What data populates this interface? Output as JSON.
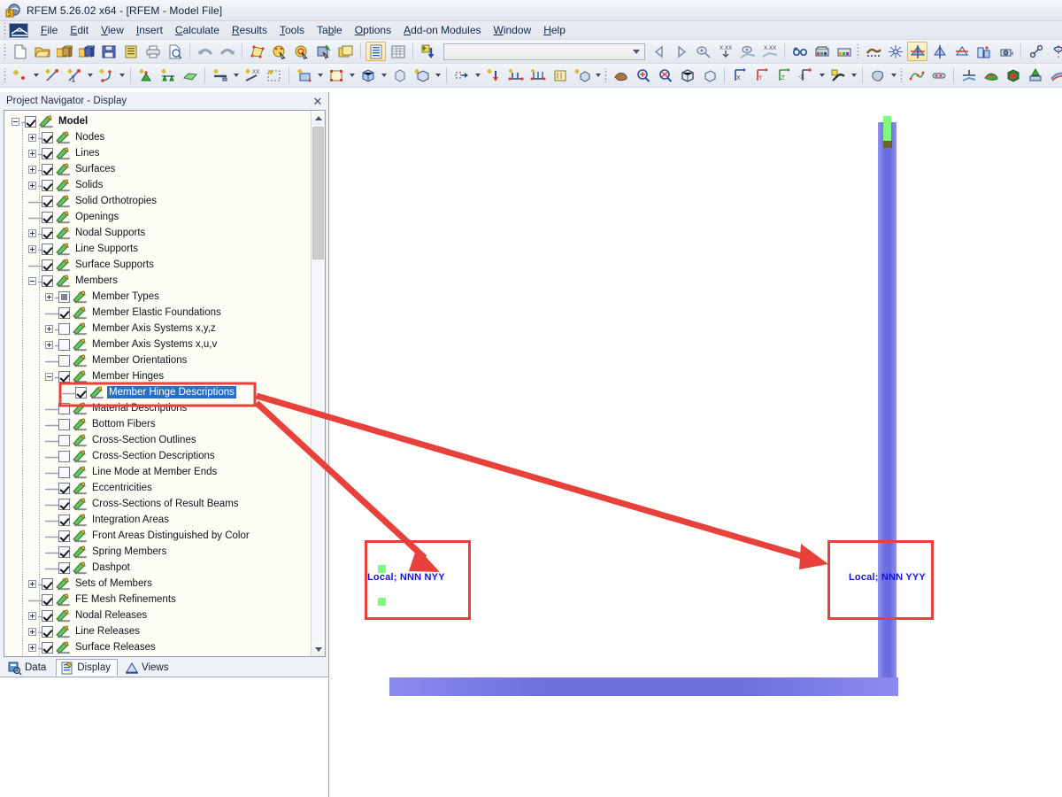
{
  "window": {
    "title": "RFEM 5.26.02 x64 - [RFEM - Model File]",
    "app_icon": "rfem-app-icon"
  },
  "menubar": {
    "app_icon": "rfem-menu-icon",
    "items": [
      {
        "label": "File",
        "accel": "F"
      },
      {
        "label": "Edit",
        "accel": "E"
      },
      {
        "label": "View",
        "accel": "V"
      },
      {
        "label": "Insert",
        "accel": "I"
      },
      {
        "label": "Calculate",
        "accel": "C"
      },
      {
        "label": "Results",
        "accel": "R"
      },
      {
        "label": "Tools",
        "accel": "T"
      },
      {
        "label": "Table",
        "accel": "b"
      },
      {
        "label": "Options",
        "accel": "O"
      },
      {
        "label": "Add-on Modules",
        "accel": "A"
      },
      {
        "label": "Window",
        "accel": "W"
      },
      {
        "label": "Help",
        "accel": "H"
      }
    ]
  },
  "toolbar_top": {
    "combo_value": "",
    "buttons": [
      "new-file-icon",
      "open-file-icon",
      "open-package-icon",
      "save-package-icon",
      "save-icon",
      "clipboard-icon",
      "print-icon",
      "print-preview-icon",
      "undo-icon",
      "redo-icon",
      "edit-model-icon",
      "select-by-mouse-icon",
      "select-special-icon",
      "select-add-icon",
      "new-window-icon",
      "table-list-icon",
      "table-grid-icon",
      "insert-object-icon"
    ],
    "buttons_right": [
      "prev-result-icon",
      "next-result-icon",
      "result-value-icon",
      "result-value-xxx-icon",
      "result-diagram-icon",
      "result-diagram-xxx-icon",
      "glasses-icon",
      "render-colors-icon",
      "render-colors2-icon",
      "fe-mesh-icon",
      "mesh-settings-icon",
      "view-model-icon",
      "view-model2-icon",
      "view-model3-icon",
      "view-building-icon",
      "camera-icon",
      "snap-icon",
      "mirror-icon",
      "mirror2-icon",
      "snap-grid-icon",
      "info-icon",
      "settings-icon",
      "gears-icon"
    ]
  },
  "toolbar_second": {
    "buttons": [
      "new-node-icon",
      "new-line-icon",
      "new-line-dim-icon",
      "new-polyline-icon",
      "new-support-icon",
      "new-line-support-icon",
      "new-surface-icon",
      "new-member-icon",
      "new-member-xx-icon",
      "new-member-select-icon",
      "new-area-icon",
      "new-frame-icon",
      "new-solid-icon",
      "new-solid2-icon",
      "new-box-icon",
      "new-opening-icon",
      "new-load-icon",
      "new-nodal-load-icon",
      "new-member-load-icon",
      "new-line-load-icon",
      "new-surface-load-icon",
      "new-free-load-icon",
      "pan-icon",
      "zoom-in-icon",
      "zoom-out-icon",
      "zoom-box-icon",
      "zoom-3d-icon",
      "view-x-icon",
      "view-y-icon",
      "view-z-icon",
      "view-negx-icon",
      "render-mode-icon",
      "isometric-icon",
      "deformation-icon",
      "result-bar-icon",
      "section-icon",
      "surface-result-icon",
      "solid-result-icon",
      "up-arrow-result-icon",
      "smooth-result-icon",
      "panels-icon",
      "result-diagram2-icon",
      "result-table-icon"
    ]
  },
  "navigator": {
    "title": "Project Navigator - Display",
    "close_icon": "close-icon",
    "tabs": [
      {
        "label": "Data",
        "icon": "data-icon",
        "active": false
      },
      {
        "label": "Display",
        "icon": "display-icon",
        "active": true
      },
      {
        "label": "Views",
        "icon": "views-icon",
        "active": false
      }
    ],
    "tree": [
      {
        "label": "Model",
        "indent": 0,
        "expander": "minus",
        "check": "checked",
        "bold": true
      },
      {
        "label": "Nodes",
        "indent": 1,
        "expander": "plus",
        "check": "checked"
      },
      {
        "label": "Lines",
        "indent": 1,
        "expander": "plus",
        "check": "checked"
      },
      {
        "label": "Surfaces",
        "indent": 1,
        "expander": "plus",
        "check": "checked"
      },
      {
        "label": "Solids",
        "indent": 1,
        "expander": "plus",
        "check": "checked"
      },
      {
        "label": "Solid Orthotropies",
        "indent": 1,
        "expander": "none",
        "check": "checked"
      },
      {
        "label": "Openings",
        "indent": 1,
        "expander": "none",
        "check": "checked"
      },
      {
        "label": "Nodal Supports",
        "indent": 1,
        "expander": "plus",
        "check": "checked"
      },
      {
        "label": "Line Supports",
        "indent": 1,
        "expander": "plus",
        "check": "checked"
      },
      {
        "label": "Surface Supports",
        "indent": 1,
        "expander": "none",
        "check": "checked"
      },
      {
        "label": "Members",
        "indent": 1,
        "expander": "minus",
        "check": "checked"
      },
      {
        "label": "Member Types",
        "indent": 2,
        "expander": "plus",
        "check": "partial"
      },
      {
        "label": "Member Elastic Foundations",
        "indent": 2,
        "expander": "none",
        "check": "checked"
      },
      {
        "label": "Member Axis Systems x,y,z",
        "indent": 2,
        "expander": "plus",
        "check": "unchecked"
      },
      {
        "label": "Member Axis Systems x,u,v",
        "indent": 2,
        "expander": "plus",
        "check": "unchecked"
      },
      {
        "label": "Member Orientations",
        "indent": 2,
        "expander": "none",
        "check": "unchecked"
      },
      {
        "label": "Member Hinges",
        "indent": 2,
        "expander": "minus",
        "check": "checked"
      },
      {
        "label": "Member Hinge Descriptions",
        "indent": 3,
        "expander": "none",
        "check": "checked",
        "selected": true
      },
      {
        "label": "Material Descriptions",
        "indent": 2,
        "expander": "none",
        "check": "unchecked"
      },
      {
        "label": "Bottom Fibers",
        "indent": 2,
        "expander": "none",
        "check": "unchecked"
      },
      {
        "label": "Cross-Section Outlines",
        "indent": 2,
        "expander": "none",
        "check": "unchecked"
      },
      {
        "label": "Cross-Section Descriptions",
        "indent": 2,
        "expander": "none",
        "check": "unchecked"
      },
      {
        "label": "Line Mode at Member Ends",
        "indent": 2,
        "expander": "none",
        "check": "unchecked"
      },
      {
        "label": "Eccentricities",
        "indent": 2,
        "expander": "none",
        "check": "checked"
      },
      {
        "label": "Cross-Sections of Result Beams",
        "indent": 2,
        "expander": "none",
        "check": "checked"
      },
      {
        "label": "Integration Areas",
        "indent": 2,
        "expander": "none",
        "check": "checked"
      },
      {
        "label": "Front Areas Distinguished by Color",
        "indent": 2,
        "expander": "none",
        "check": "checked"
      },
      {
        "label": "Spring Members",
        "indent": 2,
        "expander": "none",
        "check": "checked"
      },
      {
        "label": "Dashpot",
        "indent": 2,
        "expander": "none",
        "check": "checked"
      },
      {
        "label": "Sets of Members",
        "indent": 1,
        "expander": "plus",
        "check": "checked"
      },
      {
        "label": "FE Mesh Refinements",
        "indent": 1,
        "expander": "none",
        "check": "checked"
      },
      {
        "label": "Nodal Releases",
        "indent": 1,
        "expander": "plus",
        "check": "checked"
      },
      {
        "label": "Line Releases",
        "indent": 1,
        "expander": "plus",
        "check": "checked"
      },
      {
        "label": "Surface Releases",
        "indent": 1,
        "expander": "plus",
        "check": "checked"
      }
    ],
    "scrollbar": {
      "up_icon": "chevron-up-icon",
      "down_icon": "chevron-down-icon"
    }
  },
  "model_view": {
    "hinge_label_left": "Local; NNN NYY",
    "hinge_label_right": "Local; NNN YYY",
    "member_color": "#6f6fe0",
    "node_color": "#7dfb7d",
    "label_color": "#1414e0",
    "callout_color": "#e8403a"
  }
}
